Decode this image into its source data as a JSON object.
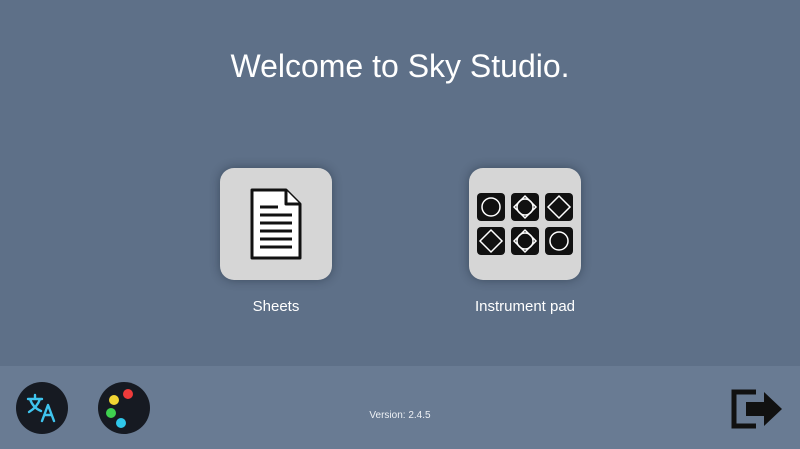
{
  "header": {
    "title": "Welcome to Sky Studio."
  },
  "menu": {
    "sheets": {
      "label": "Sheets",
      "icon": "document-icon"
    },
    "instrument_pad": {
      "label": "Instrument pad",
      "icon": "instrument-pad-grid-icon"
    }
  },
  "footer": {
    "version": "Version: 2.4.5",
    "language_icon": "translate-icon",
    "theme_icon": "palette-icon",
    "exit_icon": "exit-icon"
  },
  "colors": {
    "background": "#5e7088",
    "footer": "#697b93",
    "tile": "#d6d6d6",
    "translate_accent": "#3fc5ef"
  }
}
